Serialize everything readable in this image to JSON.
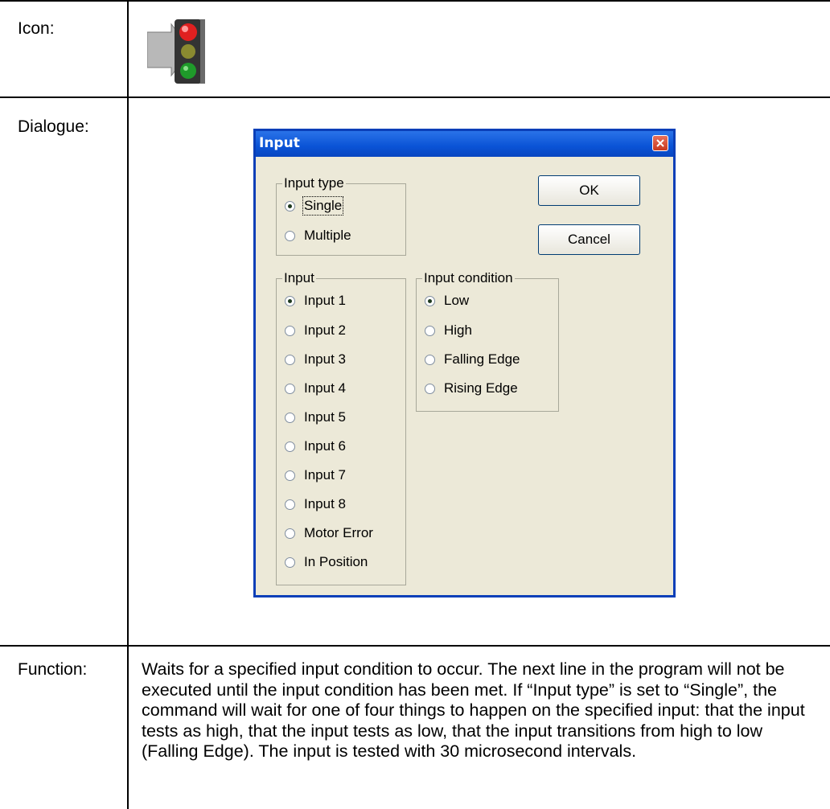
{
  "table": {
    "row_icon_label": "Icon:",
    "row_dialogue_label": "Dialogue:",
    "row_function_label": "Function:",
    "function_text": "Waits for a specified input condition to occur. The next line in the program will not be executed until the input condition has been met. If “Input type” is set to “Single”, the command will wait for one of four things to happen on the specified input: that the input tests as high, that the input tests as low, that the input transitions from high to low (Falling Edge). The input is tested with 30 microsecond intervals."
  },
  "icon": {
    "name": "traffic-light-icon"
  },
  "dialog": {
    "title": "Input",
    "ok_label": "OK",
    "cancel_label": "Cancel",
    "input_type": {
      "title": "Input type",
      "options": [
        "Single",
        "Multiple"
      ],
      "selected": "Single"
    },
    "input": {
      "title": "Input",
      "options": [
        "Input 1",
        "Input 2",
        "Input 3",
        "Input 4",
        "Input 5",
        "Input 6",
        "Input 7",
        "Input 8",
        "Motor Error",
        "In Position"
      ],
      "selected": "Input 1"
    },
    "input_condition": {
      "title": "Input condition",
      "options": [
        "Low",
        "High",
        "Falling Edge",
        "Rising Edge"
      ],
      "selected": "Low"
    }
  },
  "colors": {
    "titlebar": "#0a53d6",
    "dialog_bg": "#ece9d8",
    "close": "#c8391f"
  }
}
